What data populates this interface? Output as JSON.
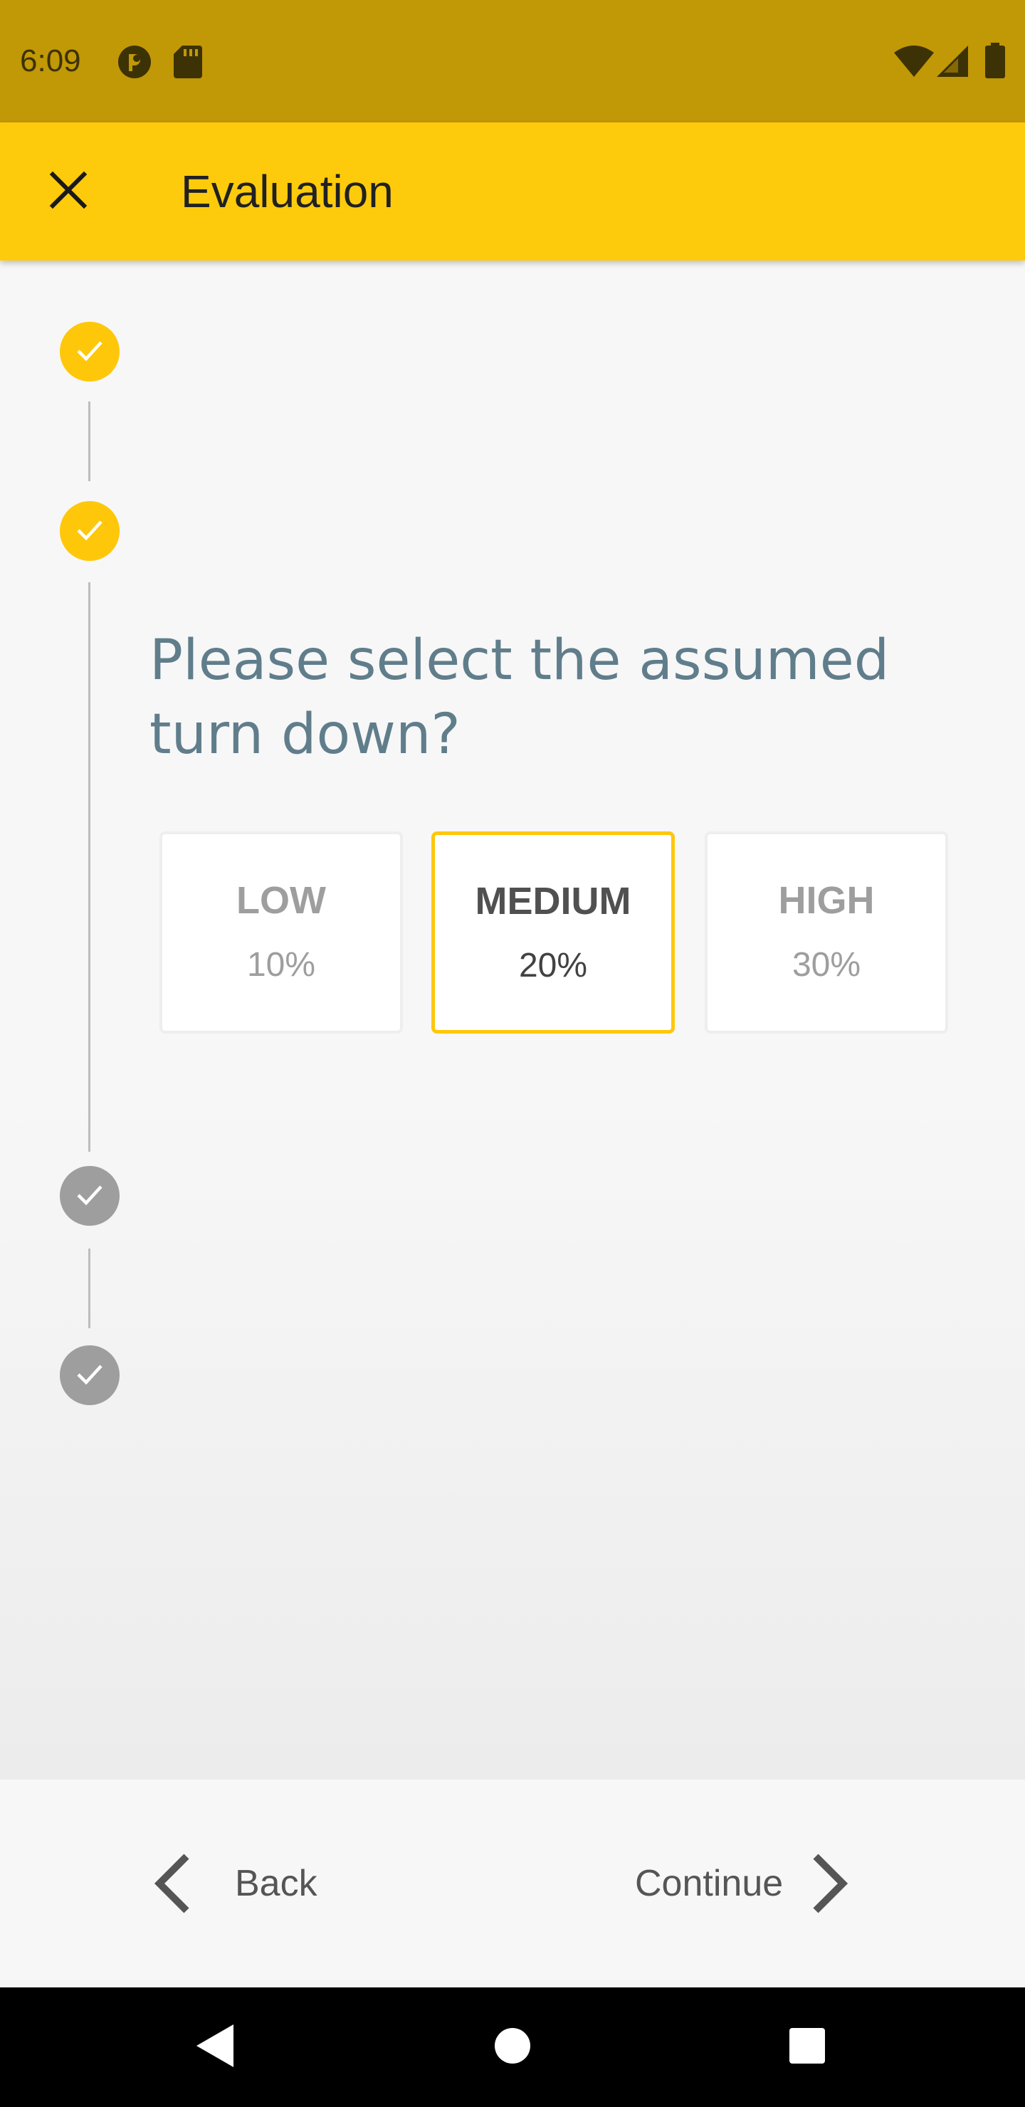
{
  "status_bar": {
    "time": "6:09",
    "icons": [
      "app-notification-icon",
      "sd-card-icon",
      "wifi-icon",
      "cellular-signal-icon",
      "battery-icon"
    ]
  },
  "app_bar": {
    "title": "Evaluation",
    "close_icon": "close-icon"
  },
  "stepper": {
    "question": "Please select the assumed turn down?",
    "steps": [
      {
        "state": "completed"
      },
      {
        "state": "current"
      },
      {
        "state": "pending"
      },
      {
        "state": "pending"
      }
    ],
    "options": [
      {
        "label": "LOW",
        "value": "10%",
        "selected": false
      },
      {
        "label": "MEDIUM",
        "value": "20%",
        "selected": true
      },
      {
        "label": "HIGH",
        "value": "30%",
        "selected": false
      }
    ]
  },
  "actions": {
    "back_label": "Back",
    "continue_label": "Continue"
  },
  "colors": {
    "status_bar": "#c19806",
    "app_bar": "#fecb0c",
    "accent": "#fec70a",
    "inactive": "#9e9e9e",
    "question_text": "#607d8b"
  }
}
